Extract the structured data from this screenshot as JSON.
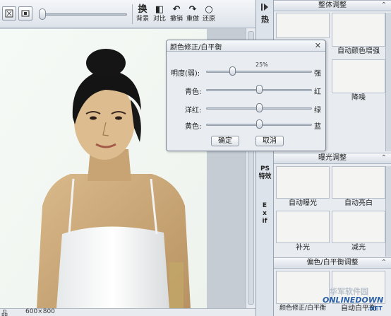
{
  "toolbar": {
    "tools": [
      {
        "glyph": "换",
        "label": "背景"
      },
      {
        "glyph": "◧",
        "label": "对比"
      },
      {
        "glyph": "↶",
        "label": "撤销"
      },
      {
        "glyph": "↷",
        "label": "重做"
      },
      {
        "glyph": "○",
        "label": "还原"
      }
    ]
  },
  "status": {
    "prefix": "品",
    "size": "600×800"
  },
  "vtabs": {
    "top": "热",
    "ps": "PS特效",
    "exif": "Exif"
  },
  "panel": {
    "sections": [
      {
        "title": "整体调整",
        "items": [
          "",
          "自动颜色增强",
          "",
          "降噪"
        ]
      },
      {
        "title": "曝光调整",
        "items": [
          "自动曝光",
          "自动亮白",
          "补光",
          "减光"
        ]
      },
      {
        "title": "偏色/白平衡调整",
        "items": [
          "颜色修正/白平衡",
          "自动白平衡"
        ]
      }
    ]
  },
  "dialog": {
    "title": "颜色修正/白平衡",
    "brightness": {
      "label": "明度(弱):",
      "right": "强",
      "value_text": "25%",
      "value": 0.25
    },
    "sliders": [
      {
        "label": "青色:",
        "right": "红",
        "value": 0.5
      },
      {
        "label": "洋红:",
        "right": "绿",
        "value": 0.5
      },
      {
        "label": "黄色:",
        "right": "蓝",
        "value": 0.5
      }
    ],
    "ok": "确定",
    "cancel": "取消",
    "close": "✕"
  },
  "watermark": {
    "cn": "华军软件园",
    "en": "ONLINEDOWN",
    "dot": ".NET"
  }
}
